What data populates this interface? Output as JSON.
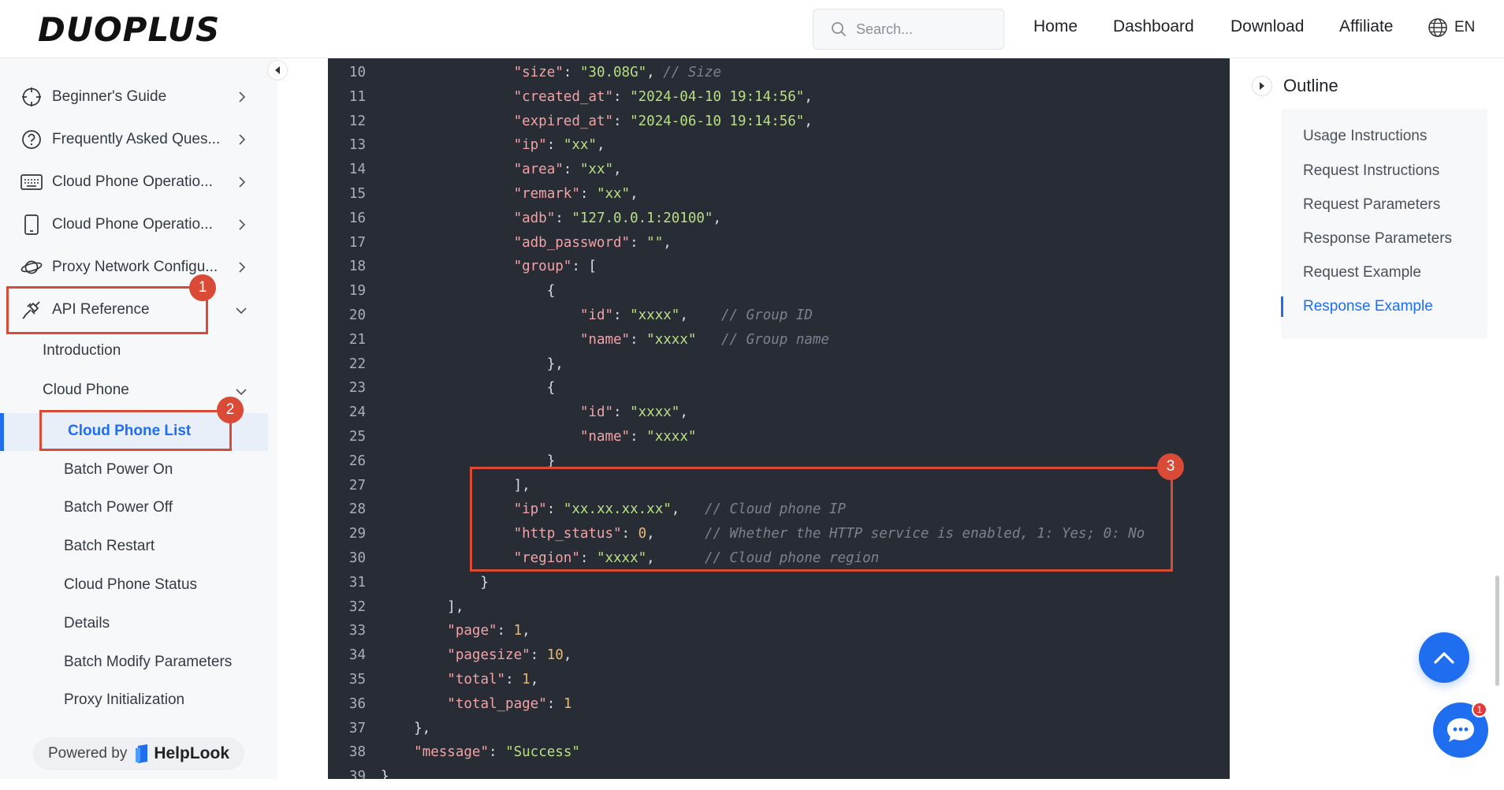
{
  "header": {
    "logo": "DUOPLUS",
    "search_placeholder": "Search...",
    "nav": [
      "Home",
      "Dashboard",
      "Download",
      "Affiliate"
    ],
    "lang": "EN"
  },
  "sidebar": {
    "items": [
      {
        "label": "Beginner's Guide",
        "icon": "crosshair-icon"
      },
      {
        "label": "Frequently Asked Ques...",
        "icon": "question-circle-icon"
      },
      {
        "label": "Cloud Phone Operatio...",
        "icon": "keyboard-icon"
      },
      {
        "label": "Cloud Phone Operatio...",
        "icon": "phone-icon"
      },
      {
        "label": "Proxy Network Configu...",
        "icon": "planet-icon"
      },
      {
        "label": "API Reference",
        "icon": "plug-icon"
      }
    ],
    "api_children": {
      "introduction": "Introduction",
      "cloud_phone": "Cloud Phone",
      "cloud_phone_children": [
        "Cloud Phone List",
        "Batch Power On",
        "Batch Power Off",
        "Batch Restart",
        "Cloud Phone Status",
        "Details",
        "Batch Modify Parameters",
        "Proxy Initialization"
      ]
    },
    "powered_by": "Powered by",
    "powered_brand": "HelpLook"
  },
  "annotations": [
    "1",
    "2",
    "3"
  ],
  "code": {
    "lines": [
      {
        "n": "10",
        "t": "                \"size\": \"30.08G\", // Size"
      },
      {
        "n": "11",
        "t": "                \"created_at\": \"2024-04-10 19:14:56\","
      },
      {
        "n": "12",
        "t": "                \"expired_at\": \"2024-06-10 19:14:56\","
      },
      {
        "n": "13",
        "t": "                \"ip\": \"xx\","
      },
      {
        "n": "14",
        "t": "                \"area\": \"xx\","
      },
      {
        "n": "15",
        "t": "                \"remark\": \"xx\","
      },
      {
        "n": "16",
        "t": "                \"adb\": \"127.0.0.1:20100\","
      },
      {
        "n": "17",
        "t": "                \"adb_password\": \"\","
      },
      {
        "n": "18",
        "t": "                \"group\": ["
      },
      {
        "n": "19",
        "t": "                    {"
      },
      {
        "n": "20",
        "t": "                        \"id\": \"xxxx\",    // Group ID"
      },
      {
        "n": "21",
        "t": "                        \"name\": \"xxxx\"   // Group name"
      },
      {
        "n": "22",
        "t": "                    },"
      },
      {
        "n": "23",
        "t": "                    {"
      },
      {
        "n": "24",
        "t": "                        \"id\": \"xxxx\","
      },
      {
        "n": "25",
        "t": "                        \"name\": \"xxxx\""
      },
      {
        "n": "26",
        "t": "                    }"
      },
      {
        "n": "27",
        "t": "                ],"
      },
      {
        "n": "28",
        "t": "                \"ip\": \"xx.xx.xx.xx\",   // Cloud phone IP"
      },
      {
        "n": "29",
        "t": "                \"http_status\": 0,      // Whether the HTTP service is enabled, 1: Yes; 0: No"
      },
      {
        "n": "30",
        "t": "                \"region\": \"xxxx\",      // Cloud phone region"
      },
      {
        "n": "31",
        "t": "            }"
      },
      {
        "n": "32",
        "t": "        ],"
      },
      {
        "n": "33",
        "t": "        \"page\": 1,"
      },
      {
        "n": "34",
        "t": "        \"pagesize\": 10,"
      },
      {
        "n": "35",
        "t": "        \"total\": 1,"
      },
      {
        "n": "36",
        "t": "        \"total_page\": 1"
      },
      {
        "n": "37",
        "t": "    },"
      },
      {
        "n": "38",
        "t": "    \"message\": \"Success\""
      },
      {
        "n": "39",
        "t": "}"
      }
    ]
  },
  "outline": {
    "title": "Outline",
    "items": [
      "Usage Instructions",
      "Request Instructions",
      "Request Parameters",
      "Response Parameters",
      "Request Example",
      "Response Example"
    ]
  },
  "chat_badge": "1",
  "colors": {
    "accent": "#1f6ef0",
    "annotation": "#d94a37",
    "code_bg": "#282c34"
  }
}
